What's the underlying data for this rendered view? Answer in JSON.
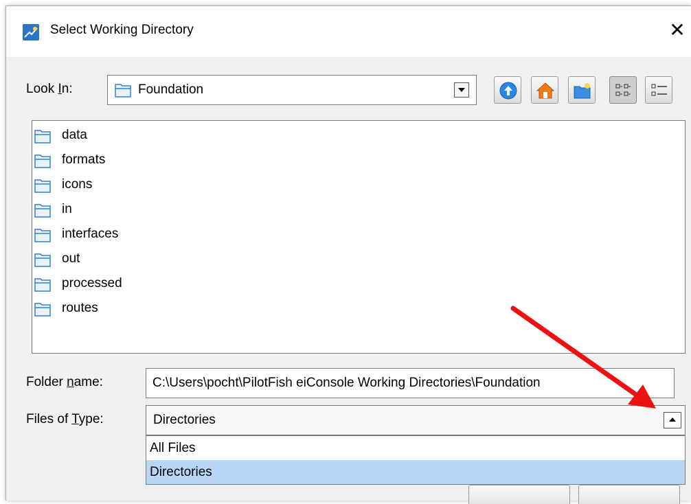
{
  "window": {
    "title": "Select Working Directory",
    "close_label": "✕"
  },
  "look_in": {
    "label_pre": "Look ",
    "label_mnemonic": "I",
    "label_post": "n:",
    "value": "Foundation"
  },
  "toolbar": {
    "up_icon": "up-one-level-icon",
    "home_icon": "home-icon",
    "new_folder_icon": "new-folder-icon",
    "list_view_icon": "list-view-icon",
    "details_view_icon": "details-view-icon"
  },
  "files": [
    {
      "name": "data"
    },
    {
      "name": "formats"
    },
    {
      "name": "icons"
    },
    {
      "name": "in"
    },
    {
      "name": "interfaces"
    },
    {
      "name": "out"
    },
    {
      "name": "processed"
    },
    {
      "name": "routes"
    }
  ],
  "folder_name": {
    "label_pre": "Folder ",
    "label_mnemonic": "n",
    "label_post": "ame:",
    "value": "C:\\Users\\pocht\\PilotFish eiConsole Working Directories\\Foundation"
  },
  "files_of_type": {
    "label_pre": "Files of ",
    "label_mnemonic": "T",
    "label_post": "ype:",
    "value": "Directories",
    "options": [
      "All Files",
      "Directories"
    ]
  },
  "colors": {
    "folder_blue": "#2f7fd8",
    "selection": "#b8d6f6",
    "annotation_arrow": "#ee1111"
  }
}
